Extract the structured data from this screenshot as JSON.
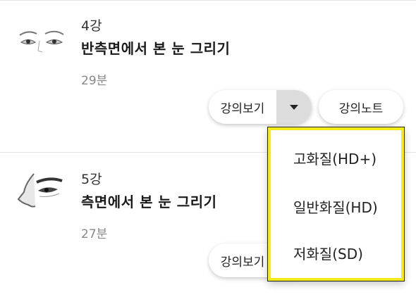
{
  "lessons": [
    {
      "number": "4강",
      "title": "반측면에서 본 눈 그리기",
      "duration": "29분",
      "thumbnail_icon": "eyes-sketch-thumbnail",
      "watch_label": "강의보기",
      "note_label": "강의노트"
    },
    {
      "number": "5강",
      "title": "측면에서 본 눈 그리기",
      "duration": "27분",
      "thumbnail_icon": "side-eye-sketch-thumbnail",
      "watch_label": "강의보기"
    }
  ],
  "quality_menu": {
    "options": [
      "고화질(HD+)",
      "일반화질(HD)",
      "저화질(SD)"
    ],
    "highlight_color": "#f5ea1a"
  }
}
